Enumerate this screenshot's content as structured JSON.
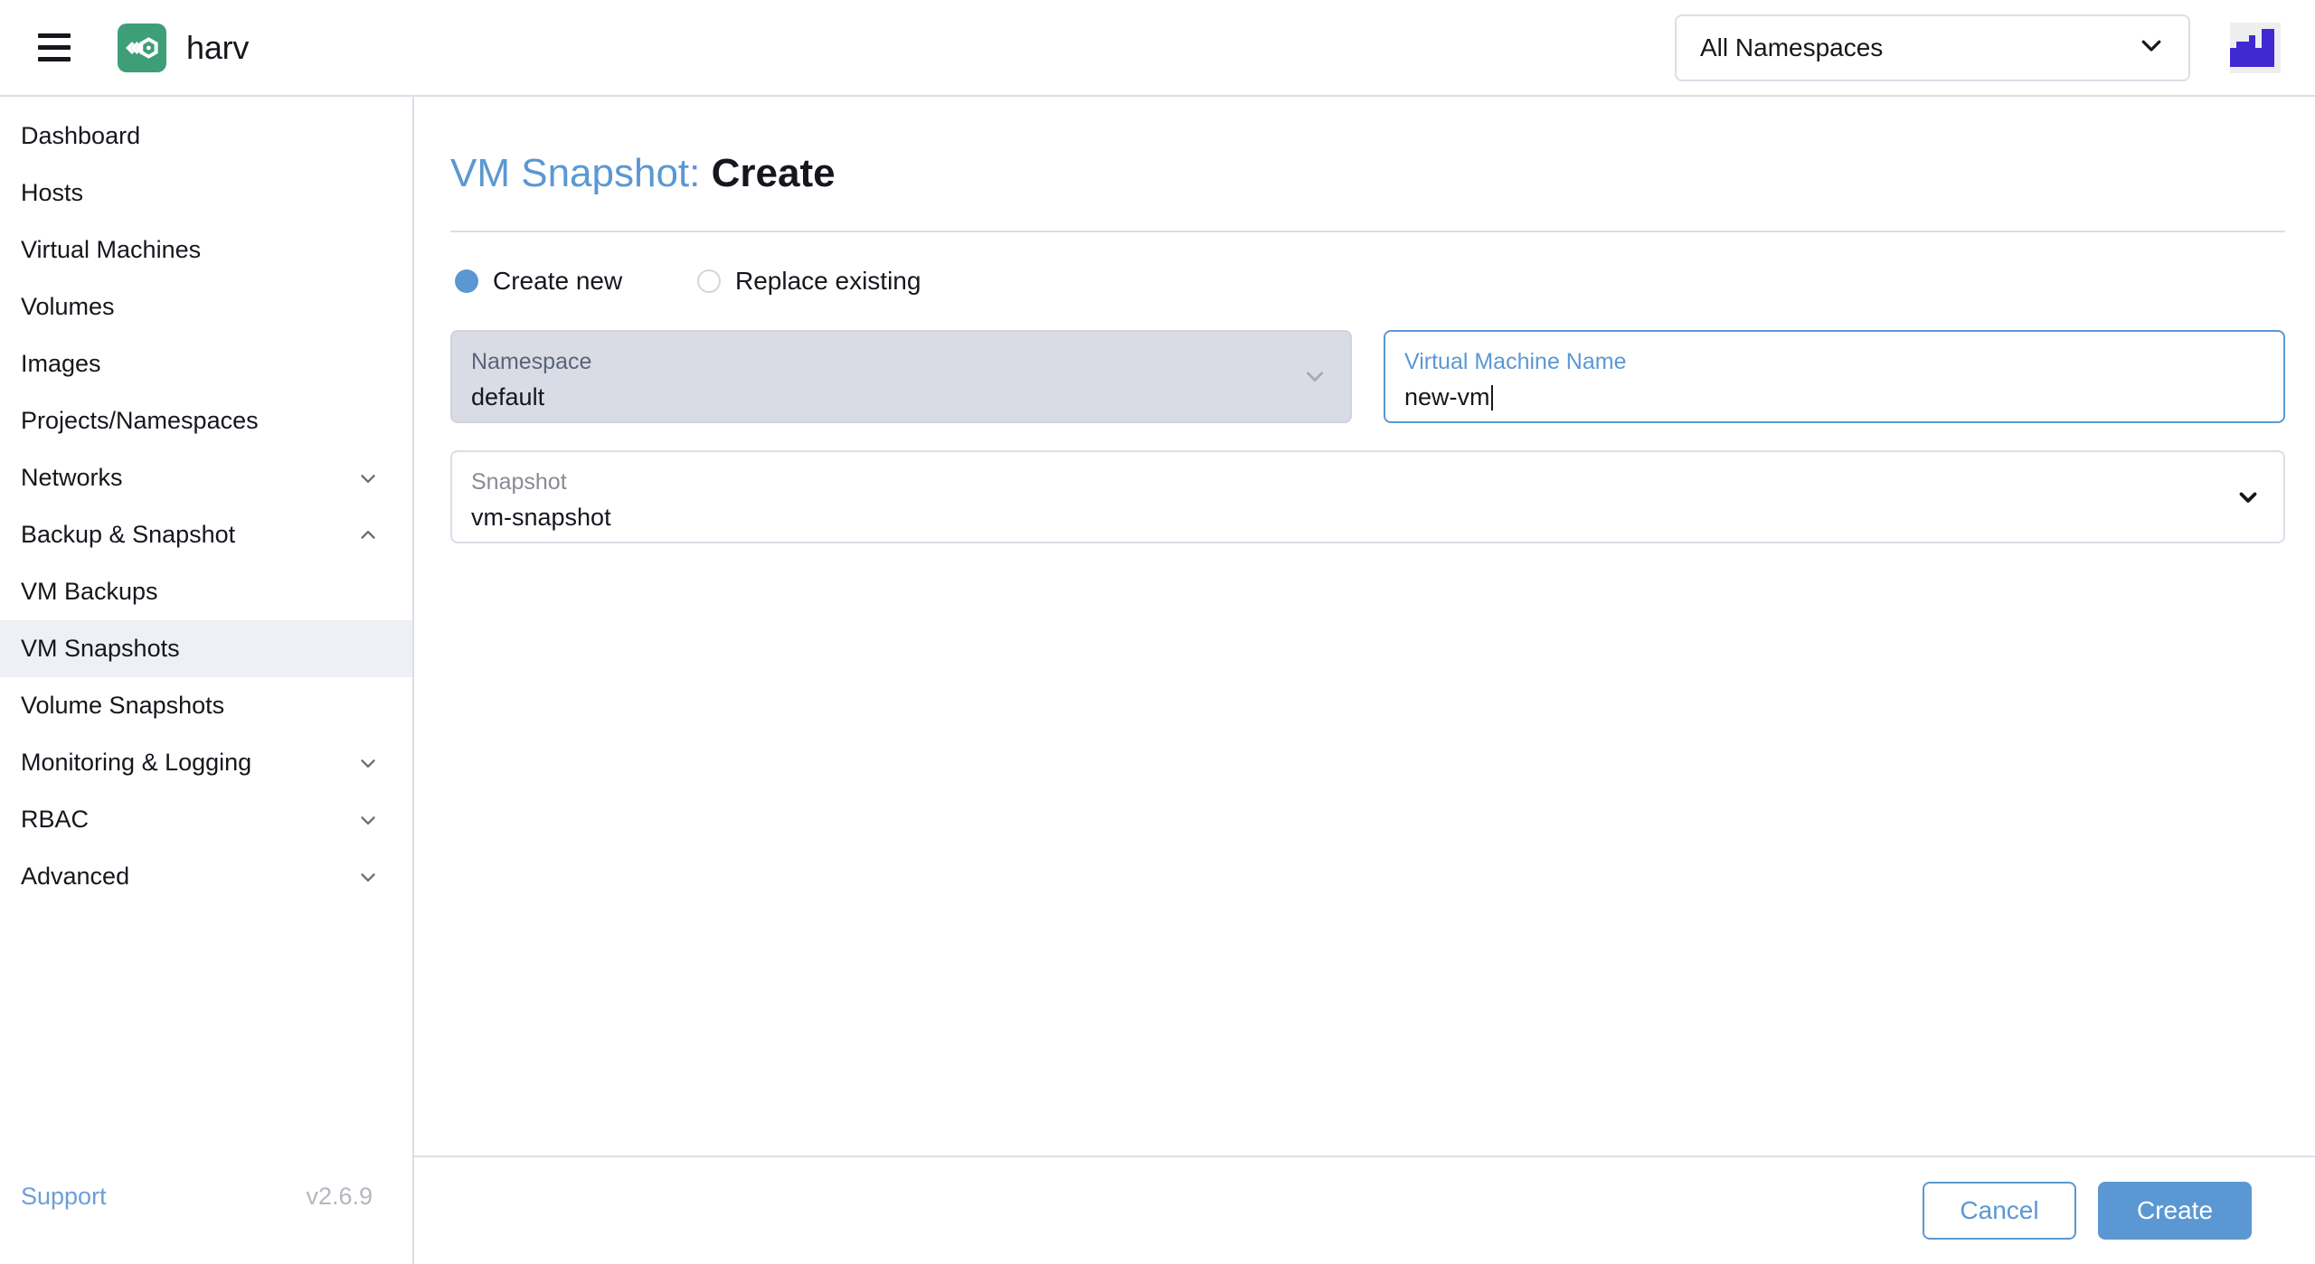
{
  "header": {
    "menu_icon": "hamburger-icon",
    "brand_name": "harv",
    "brand_logo_icon": "harvester-logo-icon",
    "namespace_filter": {
      "value": "All Namespaces",
      "chevron_icon": "chevron-down-icon"
    },
    "avatar_icon": "user-avatar-icon"
  },
  "sidebar": {
    "items": [
      {
        "label": "Dashboard",
        "type": "item"
      },
      {
        "label": "Hosts",
        "type": "item"
      },
      {
        "label": "Virtual Machines",
        "type": "item"
      },
      {
        "label": "Volumes",
        "type": "item"
      },
      {
        "label": "Images",
        "type": "item"
      },
      {
        "label": "Projects/Namespaces",
        "type": "item"
      },
      {
        "label": "Networks",
        "type": "group",
        "expanded": false,
        "chevron_icon": "chevron-down-icon"
      },
      {
        "label": "Backup & Snapshot",
        "type": "group",
        "expanded": true,
        "chevron_icon": "chevron-up-icon"
      },
      {
        "label": "VM Backups",
        "type": "child",
        "active": false
      },
      {
        "label": "VM Snapshots",
        "type": "child",
        "active": true
      },
      {
        "label": "Volume Snapshots",
        "type": "child",
        "active": false
      },
      {
        "label": "Monitoring & Logging",
        "type": "group",
        "expanded": false,
        "chevron_icon": "chevron-down-icon"
      },
      {
        "label": "RBAC",
        "type": "group",
        "expanded": false,
        "chevron_icon": "chevron-down-icon"
      },
      {
        "label": "Advanced",
        "type": "group",
        "expanded": false,
        "chevron_icon": "chevron-down-icon"
      }
    ],
    "footer": {
      "support_label": "Support",
      "version": "v2.6.9"
    }
  },
  "main": {
    "title_prefix": "VM Snapshot:",
    "title_action": "Create",
    "mode_options": [
      {
        "label": "Create new",
        "selected": true
      },
      {
        "label": "Replace existing",
        "selected": false
      }
    ],
    "fields": {
      "namespace": {
        "label": "Namespace",
        "value": "default",
        "state": "disabled",
        "chevron_icon": "chevron-down-icon"
      },
      "vm_name": {
        "label": "Virtual Machine Name",
        "value": "new-vm",
        "placeholder": "",
        "state": "focused"
      },
      "snapshot": {
        "label": "Snapshot",
        "value": "vm-snapshot",
        "state": "default",
        "chevron_icon": "chevron-down-icon"
      }
    },
    "footer_buttons": {
      "cancel_label": "Cancel",
      "create_label": "Create"
    }
  },
  "colors": {
    "accent_blue": "#5b98d3",
    "brand_green": "#3d9e77",
    "avatar_purple": "#4129d1",
    "border_gray": "#dcdee7",
    "disabled_bg": "#d9dce5",
    "active_nav_bg": "#eef0f5"
  }
}
